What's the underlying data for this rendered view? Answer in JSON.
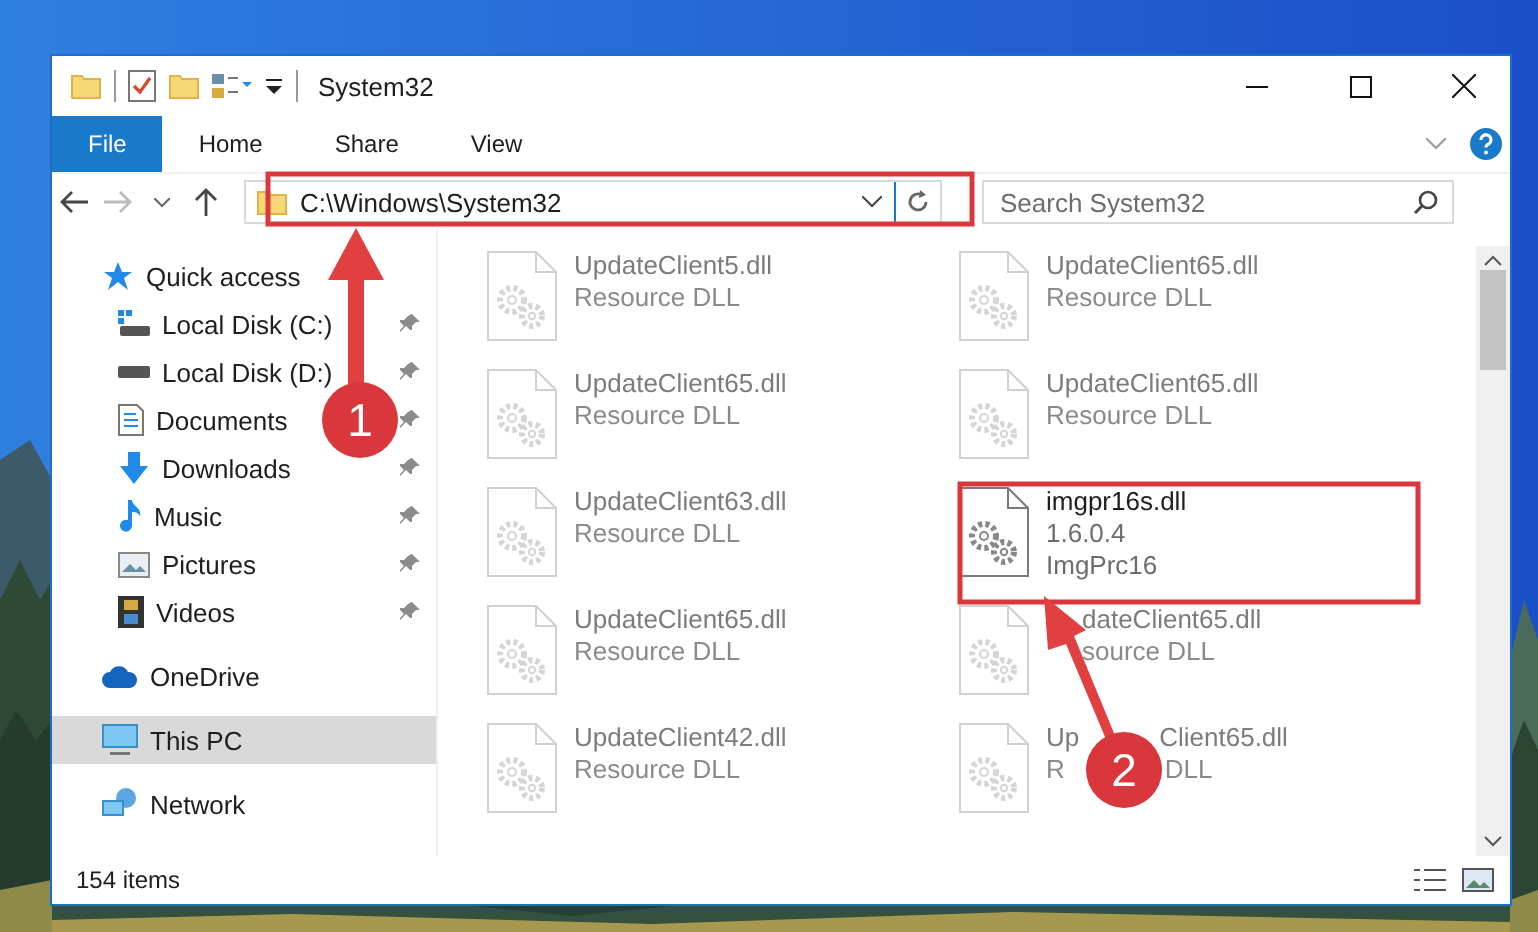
{
  "window": {
    "title": "System32"
  },
  "ribbon_tabs": [
    {
      "label": "File",
      "kind": "file"
    },
    {
      "label": "Home",
      "kind": "tab"
    },
    {
      "label": "Share",
      "kind": "tab"
    },
    {
      "label": "View",
      "kind": "tab"
    }
  ],
  "address_bar": {
    "path": "C:\\Windows\\System32"
  },
  "search": {
    "placeholder": "Search System32"
  },
  "navigation": [
    {
      "label": "Quick access",
      "selected": false,
      "children": [
        {
          "label": "Local Disk (C:)",
          "pinned": true,
          "selected": false
        },
        {
          "label": "Local Disk (D:)",
          "pinned": true,
          "selected": false
        },
        {
          "label": "Documents",
          "pinned": true,
          "selected": false
        },
        {
          "label": "Downloads",
          "pinned": true,
          "selected": false
        },
        {
          "label": "Music",
          "pinned": true,
          "selected": false
        },
        {
          "label": "Pictures",
          "pinned": true,
          "selected": false
        },
        {
          "label": "Videos",
          "pinned": true,
          "selected": false
        }
      ]
    },
    {
      "label": "OneDrive",
      "selected": false
    },
    {
      "label": "This PC",
      "selected": true
    },
    {
      "label": "Network",
      "selected": false
    }
  ],
  "files": [
    {
      "kind": "blurred",
      "name": [
        "UpdateClient5.dll"
      ],
      "details": [
        [
          "Resource DLL"
        ]
      ]
    },
    {
      "kind": "blurred",
      "name": [
        "UpdateClient65.dll"
      ],
      "details": [
        [
          "Resource DLL"
        ]
      ]
    },
    {
      "kind": "blurred",
      "name": [
        "UpdateClient65.dll"
      ],
      "details": [
        [
          "Resource DLL"
        ]
      ]
    },
    {
      "kind": "blurred",
      "name": [
        "UpdateClient65.dll"
      ],
      "details": [
        [
          "Resource DLL"
        ]
      ]
    },
    {
      "kind": "blurred",
      "name": [
        "UpdateClient63.dll"
      ],
      "details": [
        [
          "Resource DLL"
        ]
      ]
    },
    {
      "kind": "clear",
      "name": [
        "imgpr16s.dll"
      ],
      "details": [
        [
          "1.6.0.4"
        ],
        [
          "ImgPrc16"
        ]
      ]
    },
    {
      "kind": "blurred",
      "name": [
        "UpdateClient65.dll"
      ],
      "details": [
        [
          "Resource DLL"
        ]
      ]
    },
    {
      "kind": "covered_left",
      "name": [
        "dateClient65.dll"
      ],
      "details": [
        [
          "source DLL"
        ]
      ]
    },
    {
      "kind": "blurred",
      "name": [
        "UpdateClient42.dll"
      ],
      "details": [
        [
          "Resource DLL"
        ]
      ]
    },
    {
      "kind": "covered_middle",
      "name": [
        "Up",
        "Client65.dll"
      ],
      "details": [
        [
          "R",
          "DLL"
        ]
      ]
    }
  ],
  "status_bar": {
    "item_count": "154 items"
  },
  "annotations": [
    {
      "label": "1"
    },
    {
      "label": "2"
    }
  ]
}
